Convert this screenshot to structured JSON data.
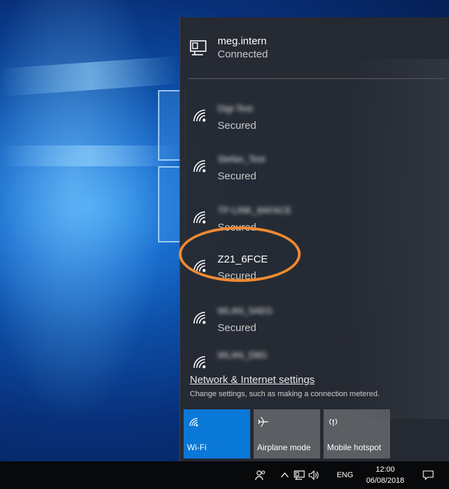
{
  "connected": {
    "name": "meg.intern",
    "status": "Connected",
    "icon": "ethernet-icon"
  },
  "networks": [
    {
      "ssid": "Digi-Test",
      "status": "Secured",
      "blurred": true
    },
    {
      "ssid": "Stefan_Test",
      "status": "Secured",
      "blurred": true
    },
    {
      "ssid": "TP-LINK_8AFACE",
      "status": "Secured",
      "blurred": true
    },
    {
      "ssid": "Z21_6FCE",
      "status": "Secured",
      "blurred": false
    },
    {
      "ssid": "WLAN_5AEG",
      "status": "Secured",
      "blurred": true
    },
    {
      "ssid": "WLAN_D8G",
      "status": "",
      "blurred": true
    }
  ],
  "settings": {
    "link": "Network & Internet settings",
    "description": "Change settings, such as making a connection metered."
  },
  "quick_actions": [
    {
      "label": "Wi-Fi",
      "icon": "wifi-icon",
      "active": true
    },
    {
      "label": "Airplane mode",
      "icon": "airplane-icon",
      "active": false
    },
    {
      "label": "Mobile hotspot",
      "icon": "hotspot-icon",
      "active": false
    }
  ],
  "taskbar": {
    "language": "ENG",
    "time": "12:00",
    "date": "06/08/2018"
  },
  "colors": {
    "flyout_bg": "#26292e",
    "accent": "#0a78d7",
    "highlight": "#f08a30",
    "tile": "#5b5e62"
  }
}
